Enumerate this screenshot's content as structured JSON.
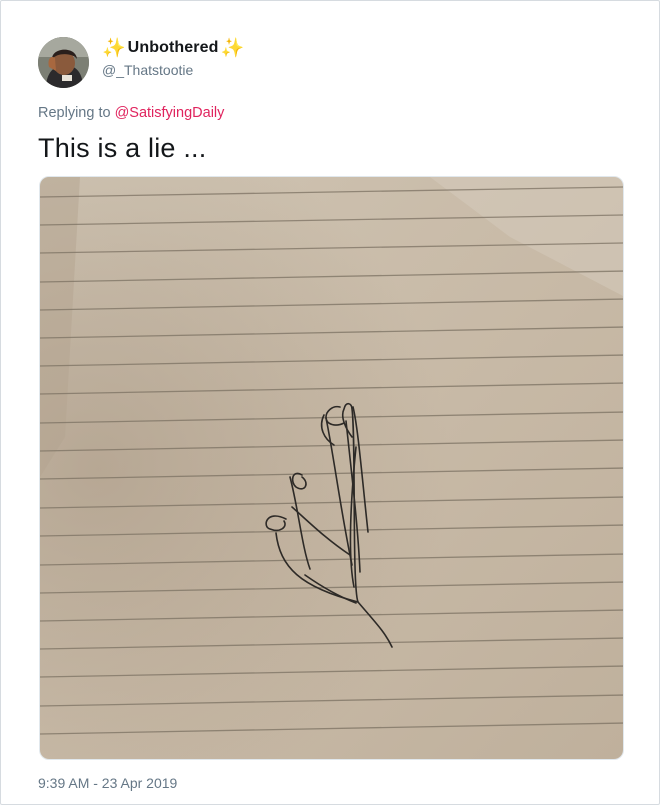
{
  "author": {
    "sparkle_left": "✨",
    "display_name": "Unbothered",
    "sparkle_right": "✨",
    "handle": "@_Thatstootie"
  },
  "reply": {
    "prefix": "Replying to",
    "mention": "@SatisfyingDaily"
  },
  "tweet": {
    "text": "This is a lie ...",
    "timestamp": "9:39 AM - 23 Apr 2019"
  },
  "colors": {
    "mention": "#e0245e",
    "muted": "#657786",
    "text": "#14171a",
    "paper": "#c9bcaa"
  }
}
